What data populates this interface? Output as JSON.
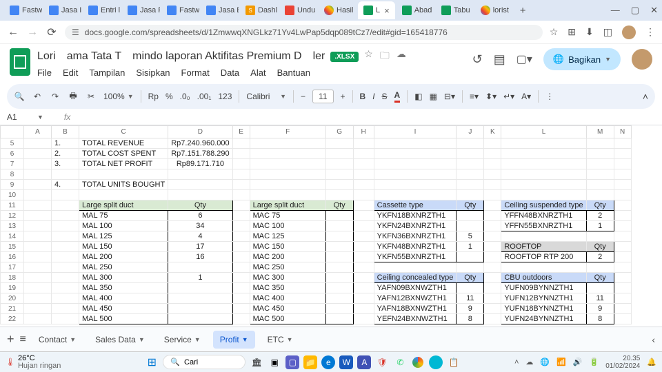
{
  "browser": {
    "tabs": [
      "Fastw",
      "Jasa I",
      "Entri l",
      "Jasa P",
      "Fastw",
      "Jasa E",
      "Dashl",
      "Undu",
      "Hasil",
      "L",
      "Abad",
      "Tabu",
      "lorist"
    ],
    "active_tab_index": 9,
    "url": "docs.google.com/spreadsheets/d/1ZmwwqXNGLkz71Yv4LwPap5dqp089tCz7/edit#gid=165418776",
    "new_tab": "+"
  },
  "doc": {
    "title_partial_left": "Lori",
    "title_partial_mid": "ama Tata T",
    "title_partial_right": "mindo laporan Aktifitas Premium D",
    "title_partial_end": "ler",
    "badge": ".XLSX",
    "menus": [
      "File",
      "Edit",
      "Tampilan",
      "Sisipkan",
      "Format",
      "Data",
      "Alat",
      "Bantuan"
    ],
    "share": "Bagikan"
  },
  "tb": {
    "zoom": "100%",
    "rp": "Rp",
    "pct": "%",
    "d1": ".0₀",
    "d2": ".00₁",
    "n123": "123",
    "font": "Calibri",
    "size": "11",
    "minus": "−",
    "plus": "+"
  },
  "formula": {
    "cell": "A1",
    "fx": "fx"
  },
  "cols": [
    "A",
    "B",
    "C",
    "D",
    "E",
    "F",
    "G",
    "H",
    "I",
    "J",
    "K",
    "L",
    "M",
    "N"
  ],
  "row_start": 5,
  "summary": {
    "r5b": "1.",
    "r5c": "TOTAL REVENUE",
    "r5d": "Rp7.240.960.000",
    "r6b": "2.",
    "r6c": "TOTAL COST SPENT",
    "r6d": "Rp7.151.788.290",
    "r7b": "3.",
    "r7c": "TOTAL NET PROFIT",
    "r7d": "Rp89.171.710",
    "r9b": "4.",
    "r9c": "TOTAL UNITS BOUGHT"
  },
  "t1": {
    "h1": "Large split duct",
    "h2": "Qty",
    "rows": [
      [
        "MAL 75",
        "6"
      ],
      [
        "MAL 100",
        "34"
      ],
      [
        "MAL 125",
        "4"
      ],
      [
        "MAL 150",
        "17"
      ],
      [
        "MAL 200",
        "16"
      ],
      [
        "MAL 250",
        ""
      ],
      [
        "MAL 300",
        "1"
      ],
      [
        "MAL 350",
        ""
      ],
      [
        "MAL 400",
        ""
      ],
      [
        "MAL 450",
        ""
      ],
      [
        "MAL 500",
        ""
      ]
    ]
  },
  "t2": {
    "h1": "Large split duct",
    "h2": "Qty",
    "rows": [
      [
        "MAC 75",
        ""
      ],
      [
        "MAC 100",
        ""
      ],
      [
        "MAC 125",
        ""
      ],
      [
        "MAC 150",
        ""
      ],
      [
        "MAC 200",
        ""
      ],
      [
        "MAC 250",
        ""
      ],
      [
        "MAC 300",
        ""
      ],
      [
        "MAC 350",
        ""
      ],
      [
        "MAC 400",
        ""
      ],
      [
        "MAC 450",
        ""
      ],
      [
        "MAC 500",
        ""
      ]
    ]
  },
  "t3": {
    "h1": "Cassette type",
    "h2": "Qty",
    "rows": [
      [
        "YKFN18BXNRZTH1",
        ""
      ],
      [
        "YKFN24BXNRZTH1",
        ""
      ],
      [
        "YKFN36BXNRZTH1",
        "5"
      ],
      [
        "YKFN48BXNRZTH1",
        "1"
      ],
      [
        "YKFN55BXNRZTH1",
        ""
      ]
    ]
  },
  "t4": {
    "h1": "Ceiling concealed type",
    "h2": "Qty",
    "rows": [
      [
        "YAFN09BXNWZTH1",
        ""
      ],
      [
        "YAFN12BXNWZTH1",
        "11"
      ],
      [
        "YAFN18BXNWZTH1",
        "9"
      ],
      [
        "YEFN24BXNWZTH1",
        "8"
      ]
    ]
  },
  "t5": {
    "h1": "Ceiling suspended type",
    "h2": "Qty",
    "rows": [
      [
        "YFFN48BXNRZTH1",
        "2"
      ],
      [
        "YFFN55BXNRZTH1",
        "1"
      ]
    ]
  },
  "t6": {
    "h1": "ROOFTOP",
    "h2": "Qty",
    "rows": [
      [
        "ROOFTOP RTP 200",
        "2"
      ]
    ]
  },
  "t7": {
    "h1": "CBU outdoors",
    "h2": "Qty",
    "rows": [
      [
        "YUFN09BYNNZTH1",
        ""
      ],
      [
        "YUFN12BYNNZTH1",
        "11"
      ],
      [
        "YUFN18BYNNZTH1",
        "9"
      ],
      [
        "YUFN24BYNNZTH1",
        "8"
      ]
    ]
  },
  "sheets": {
    "add": "+",
    "menu": "≡",
    "tabs": [
      "Contact",
      "Sales Data",
      "Service",
      "Profit",
      "ETC"
    ],
    "active": 3
  },
  "taskbar": {
    "temp": "26°C",
    "cond": "Hujan ringan",
    "search": "Cari",
    "time": "20.35",
    "date": "01/02/2024"
  }
}
